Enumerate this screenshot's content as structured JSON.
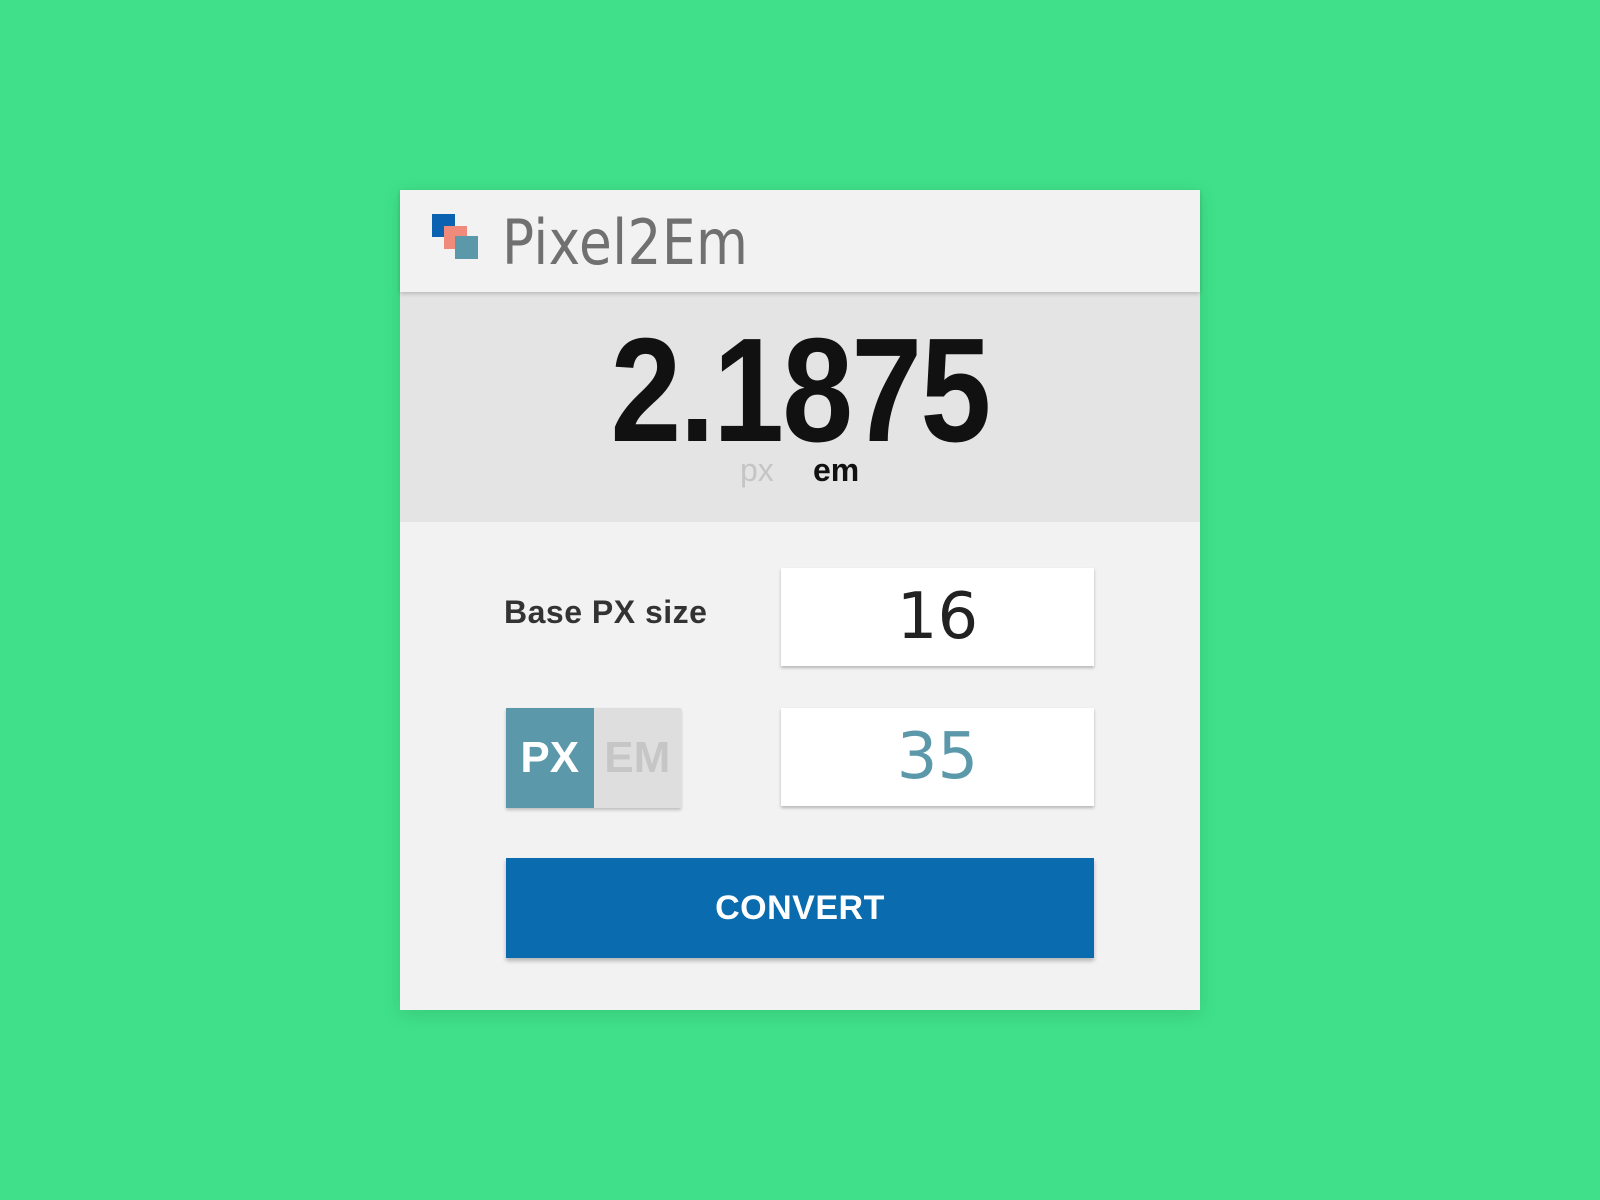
{
  "app": {
    "title": "Pixel2Em"
  },
  "result": {
    "value": "2.1875",
    "unit_px": "px",
    "unit_em": "em",
    "active_unit": "em"
  },
  "form": {
    "base_label": "Base PX size",
    "base_value": "16",
    "toggle_px": "PX",
    "toggle_em": "EM",
    "toggle_selected": "PX",
    "input_value": "35",
    "convert_label": "CONVERT"
  },
  "colors": {
    "background": "#3fe089",
    "accent_blue": "#0a6baf",
    "accent_teal": "#5b98aa",
    "logo_coral": "#f08a7a"
  },
  "icons": {
    "logo": "overlapping-squares-logo-icon"
  }
}
